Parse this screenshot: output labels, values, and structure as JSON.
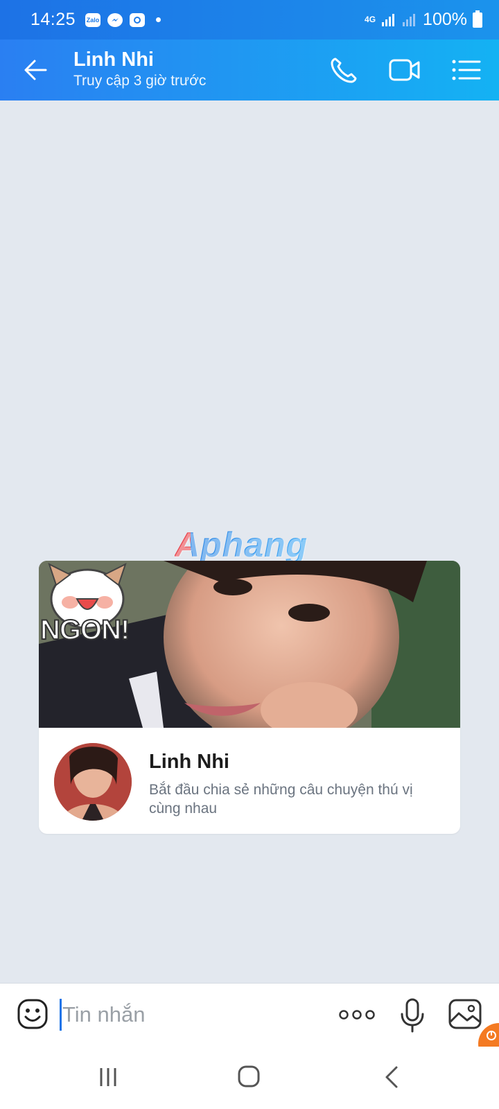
{
  "status_bar": {
    "time": "14:25",
    "notifications": [
      "zalo-icon",
      "messenger-icon",
      "screen-recorder-icon"
    ],
    "network": "4G",
    "battery": "100%"
  },
  "header": {
    "name": "Linh Nhi",
    "subtitle": "Truy cập 3 giờ trước",
    "icons": [
      "back-arrow-icon",
      "phone-icon",
      "video-call-icon",
      "list-menu-icon"
    ],
    "accent_color": "#1b8bec"
  },
  "watermark": "Aphang",
  "profile_card": {
    "sticker_text": "NGON!",
    "name": "Linh Nhi",
    "description": "Bắt đầu chia sẻ những câu chuyện thú vị cùng nhau"
  },
  "input_bar": {
    "placeholder": "Tin nhắn",
    "icons": [
      "emoji-icon",
      "more-icon",
      "microphone-icon",
      "image-icon"
    ]
  },
  "nav_bar": {
    "icons": [
      "recent-apps-icon",
      "home-icon",
      "back-icon"
    ]
  }
}
